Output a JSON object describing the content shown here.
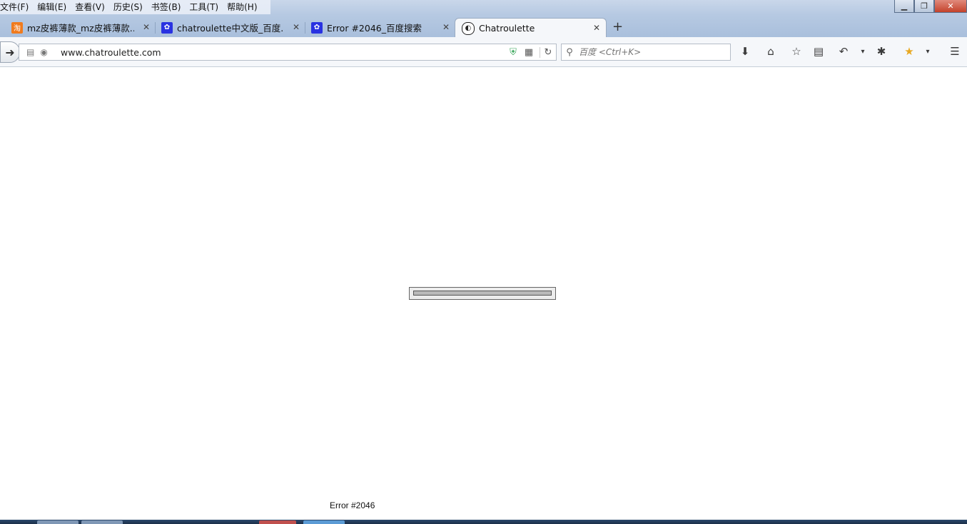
{
  "menubar": [
    "文件(F)",
    "编辑(E)",
    "查看(V)",
    "历史(S)",
    "书签(B)",
    "工具(T)",
    "帮助(H)"
  ],
  "window_controls": {
    "minimize": "▁",
    "maximize": "❐",
    "close": "✕"
  },
  "tabs": [
    {
      "title": "mz皮裤薄款_mz皮裤薄款...",
      "favicon": "taobao-icon",
      "favicon_color": "#f07b1e",
      "favicon_glyph": "淘"
    },
    {
      "title": "chatroulette中文版_百度...",
      "favicon": "baidu-paw-icon",
      "favicon_color": "#2932e1",
      "favicon_glyph": "✿"
    },
    {
      "title": "Error #2046_百度搜索",
      "favicon": "baidu-paw-icon",
      "favicon_color": "#2932e1",
      "favicon_glyph": "✿"
    },
    {
      "title": "Chatroulette",
      "favicon": "chatroulette-icon",
      "favicon_color": "#222222",
      "favicon_glyph": "◐",
      "active": true
    }
  ],
  "tab_close_glyph": "✕",
  "new_tab_glyph": "+",
  "navbar": {
    "url": "www.chatroulette.com",
    "search_placeholder": "百度 <Ctrl+K>"
  },
  "content": {
    "error_text": "Error #2046",
    "loading_progress": 1.0
  },
  "colors": {
    "accent": "#3aa65b",
    "chrome_bg": "#f5f7fa"
  }
}
